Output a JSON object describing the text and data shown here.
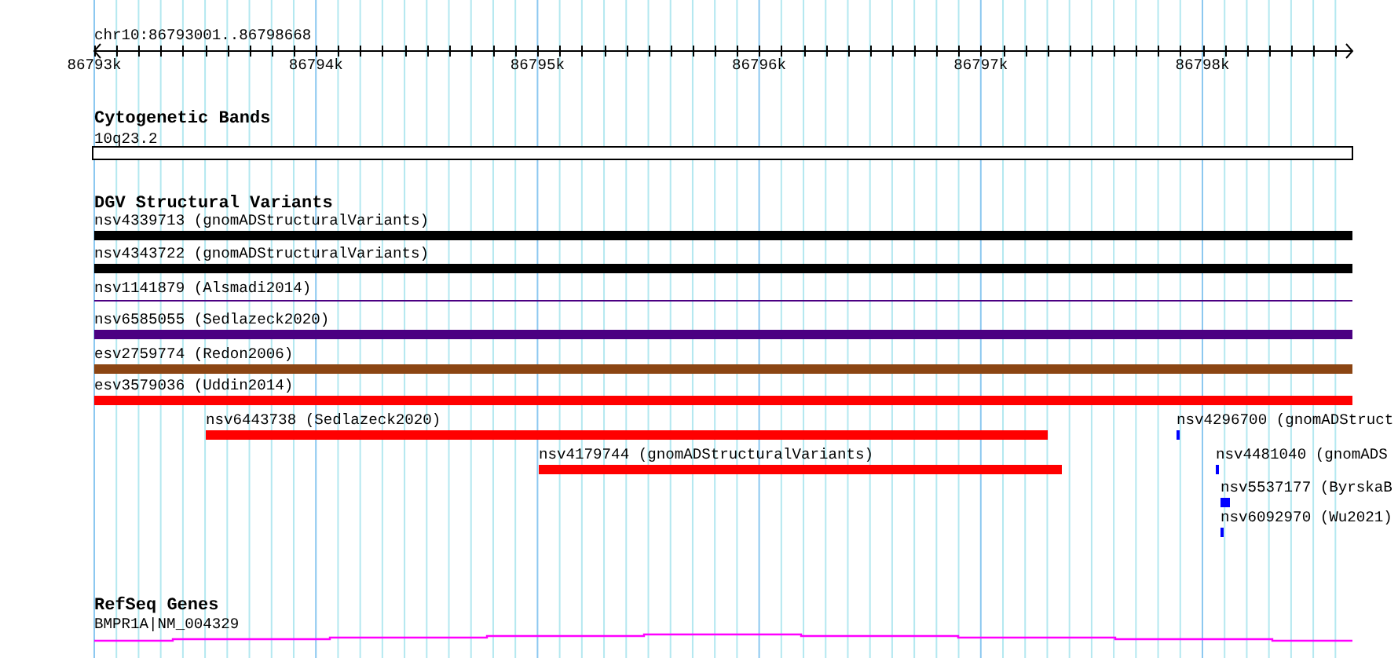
{
  "ruler": {
    "region": "chr10:86793001..86798668",
    "ticks": [
      "86793k",
      "86794k",
      "86795k",
      "86796k",
      "86797k",
      "86798k"
    ]
  },
  "tracks": [
    {
      "kind": "bands",
      "title": "Cytogenetic Bands",
      "items": [
        {
          "label": "10q23.2"
        }
      ]
    },
    {
      "kind": "variants",
      "title": "DGV Structural Variants",
      "items": [
        {
          "label": "nsv4339713 (gnomADStructuralVariants)",
          "color": "#000000",
          "kind": "bar"
        },
        {
          "label": "nsv4343722 (gnomADStructuralVariants)",
          "color": "#000000",
          "kind": "bar"
        },
        {
          "label": "nsv1141879 (Alsmadi2014)",
          "color": "#4b0082",
          "kind": "line"
        },
        {
          "label": "nsv6585055 (Sedlazeck2020)",
          "color": "#4b0082",
          "kind": "bar"
        },
        {
          "label": "esv2759774 (Redon2006)",
          "color": "#8b4513",
          "kind": "bar"
        },
        {
          "label": "esv3579036 (Uddin2014)",
          "color": "#ff0000",
          "kind": "bar"
        },
        {
          "label": "nsv6443738 (Sedlazeck2020)",
          "color": "#ff0000",
          "kind": "bar"
        },
        {
          "label": "nsv4179744 (gnomADStructuralVariants)",
          "color": "#ff0000",
          "kind": "bar"
        },
        {
          "label": "nsv4296700 (gnomADStruct",
          "color": "#0000ff",
          "kind": "bar"
        },
        {
          "label": "nsv4481040 (gnomADS",
          "color": "#0000ff",
          "kind": "bar"
        },
        {
          "label": "nsv5537177 (ByrskaB",
          "color": "#0000ff",
          "kind": "bar"
        },
        {
          "label": "nsv6092970 (Wu2021)",
          "color": "#0000ff",
          "kind": "bar"
        }
      ]
    },
    {
      "kind": "genes",
      "title": "RefSeq Genes",
      "items": [
        {
          "label": "BMPR1A|NM_004329"
        }
      ]
    }
  ]
}
